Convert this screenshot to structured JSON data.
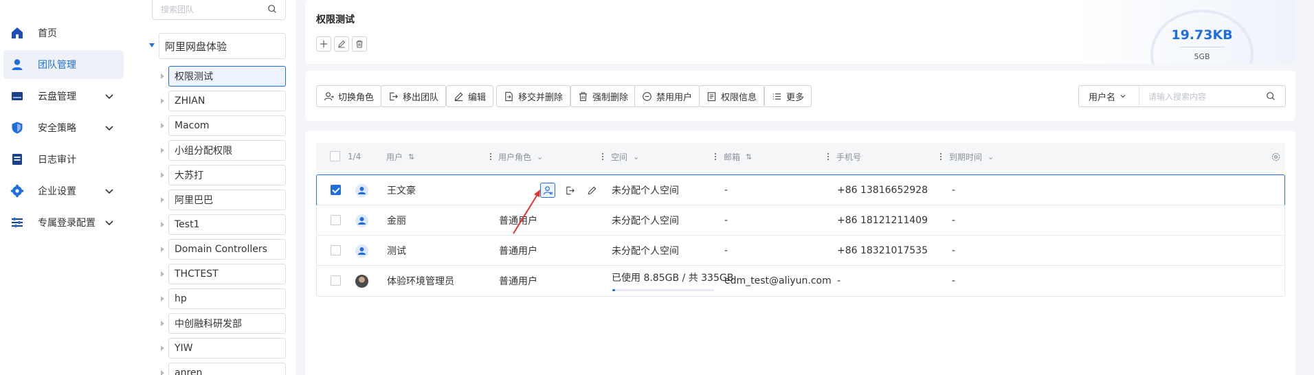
{
  "nav": {
    "items": [
      {
        "label": "首页",
        "icon": "home-icon",
        "active": false,
        "expandable": false
      },
      {
        "label": "团队管理",
        "icon": "user-icon",
        "active": true,
        "expandable": false
      },
      {
        "label": "云盘管理",
        "icon": "cloud-disk-icon",
        "active": false,
        "expandable": true
      },
      {
        "label": "安全策略",
        "icon": "shield-icon",
        "active": false,
        "expandable": true
      },
      {
        "label": "日志审计",
        "icon": "log-icon",
        "active": false,
        "expandable": false
      },
      {
        "label": "企业设置",
        "icon": "enterprise-gear-icon",
        "active": false,
        "expandable": true
      },
      {
        "label": "专属登录配置",
        "icon": "sliders-icon",
        "active": false,
        "expandable": true
      }
    ]
  },
  "tree": {
    "search_placeholder": "搜索团队",
    "root": "阿里网盘体验",
    "children": [
      "权限测试",
      "ZHIAN",
      "Macom",
      "小组分配权限",
      "大苏打",
      "阿里巴巴",
      "Test1",
      "Domain Controllers",
      "THCTEST",
      "hp",
      "中创融科研发部",
      "YIW",
      "anren"
    ],
    "selected_index": 0
  },
  "header": {
    "title": "权限测试",
    "quota_used": "19.73KB",
    "quota_total": "5GB"
  },
  "toolbar": {
    "buttons": [
      "切换角色",
      "移出团队",
      "编辑",
      "移交并删除",
      "强制删除",
      "禁用用户",
      "权限信息",
      "更多"
    ],
    "filter_field": "用户名",
    "filter_placeholder": "请输入搜索内容"
  },
  "table": {
    "selection_count": "1/4",
    "columns": [
      "用户",
      "用户角色",
      "空间",
      "邮箱",
      "手机号",
      "到期时间"
    ],
    "rows": [
      {
        "name": "王文豪",
        "role": "",
        "space": "未分配个人空间",
        "email": "-",
        "phone": "+86 13816652928",
        "expire": "-",
        "checked": true,
        "avatar": "default"
      },
      {
        "name": "金丽",
        "role": "普通用户",
        "space": "未分配个人空间",
        "email": "-",
        "phone": "+86 18121211409",
        "expire": "-",
        "checked": false,
        "avatar": "default"
      },
      {
        "name": "测试",
        "role": "普通用户",
        "space": "未分配个人空间",
        "email": "-",
        "phone": "+86 18321017535",
        "expire": "-",
        "checked": false,
        "avatar": "default"
      },
      {
        "name": "体验环境管理员",
        "role": "普通用户",
        "space": "已使用 8.85GB / 共 335GB",
        "email": "edm_test@aliyun.com",
        "phone": "-",
        "expire": "-",
        "checked": false,
        "avatar": "photo",
        "usage_fraction": 0.026
      }
    ]
  },
  "colors": {
    "accent": "#1f6dde",
    "annotation_arrow": "#e03030"
  }
}
